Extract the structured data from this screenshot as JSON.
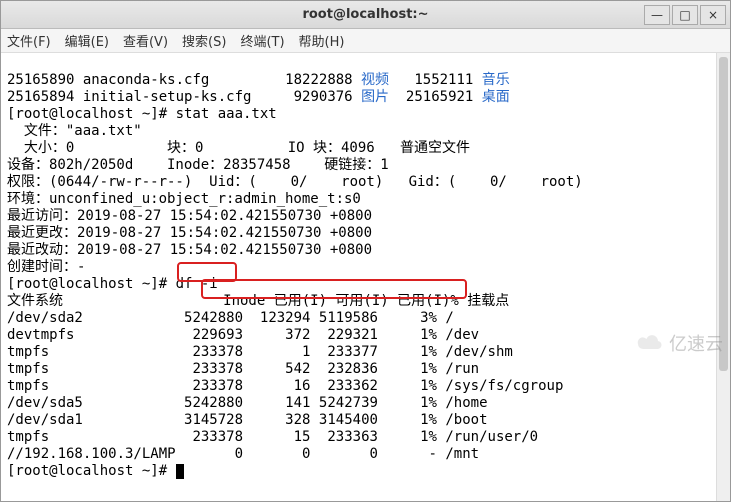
{
  "window": {
    "title": "root@localhost:~"
  },
  "menu": {
    "file": "文件(F)",
    "edit": "编辑(E)",
    "view": "查看(V)",
    "search": "搜索(S)",
    "terminal": "终端(T)",
    "help": "帮助(H)"
  },
  "win_controls": {
    "min": "—",
    "max": "□",
    "close": "×"
  },
  "ls_output": [
    {
      "inode": "25165890",
      "name": "anaconda-ks.cfg",
      "c2_inode": "18222888",
      "c2_name": "视频",
      "c3_inode": "1552111",
      "c3_name": "音乐"
    },
    {
      "inode": "25165894",
      "name": "initial-setup-ks.cfg",
      "c2_inode": "9290376",
      "c2_name": "图片",
      "c3_inode": "25165921",
      "c3_name": "桌面"
    }
  ],
  "stat": {
    "prompt": "[root@localhost ~]# stat aaa.txt",
    "file_label": "  文件：\"aaa.txt\"",
    "size_line": "  大小：0           块：0          IO 块：4096   普通空文件",
    "device_line": "设备：802h/2050d    Inode：28357458    硬链接：1",
    "perm_line": "权限：(0644/-rw-r--r--)  Uid：(    0/    root)   Gid：(    0/    root)",
    "context_line": "环境：unconfined_u:object_r:admin_home_t:s0",
    "atime": "最近访问：2019-08-27 15:54:02.421550730 +0800",
    "mtime": "最近更改：2019-08-27 15:54:02.421550730 +0800",
    "ctime": "最近改动：2019-08-27 15:54:02.421550730 +0800",
    "btime": "创建时间：-"
  },
  "df": {
    "prompt": "[root@localhost ~]# df -i",
    "header": "文件系统                   Inode 已用(I) 可用(I) 已用(I)% 挂载点",
    "rows": [
      {
        "fs": "/dev/sda2           ",
        "inodes": "5242880",
        "iused": " 123294",
        "ifree": "5119586",
        "pct": "    3%",
        "mount": " /"
      },
      {
        "fs": "devtmpfs            ",
        "inodes": " 229693",
        "iused": "    372",
        "ifree": " 229321",
        "pct": "    1%",
        "mount": " /dev"
      },
      {
        "fs": "tmpfs               ",
        "inodes": " 233378",
        "iused": "      1",
        "ifree": " 233377",
        "pct": "    1%",
        "mount": " /dev/shm"
      },
      {
        "fs": "tmpfs               ",
        "inodes": " 233378",
        "iused": "    542",
        "ifree": " 232836",
        "pct": "    1%",
        "mount": " /run"
      },
      {
        "fs": "tmpfs               ",
        "inodes": " 233378",
        "iused": "     16",
        "ifree": " 233362",
        "pct": "    1%",
        "mount": " /sys/fs/cgroup"
      },
      {
        "fs": "/dev/sda5           ",
        "inodes": "5242880",
        "iused": "    141",
        "ifree": "5242739",
        "pct": "    1%",
        "mount": " /home"
      },
      {
        "fs": "/dev/sda1           ",
        "inodes": "3145728",
        "iused": "    328",
        "ifree": "3145400",
        "pct": "    1%",
        "mount": " /boot"
      },
      {
        "fs": "tmpfs               ",
        "inodes": " 233378",
        "iused": "     15",
        "ifree": " 233363",
        "pct": "    1%",
        "mount": " /run/user/0"
      },
      {
        "fs": "//192.168.100.3/LAMP",
        "inodes": "      0",
        "iused": "      0",
        "ifree": "      0",
        "pct": "     -",
        "mount": " /mnt"
      }
    ]
  },
  "final_prompt": "[root@localhost ~]# ",
  "watermark": "亿速云"
}
